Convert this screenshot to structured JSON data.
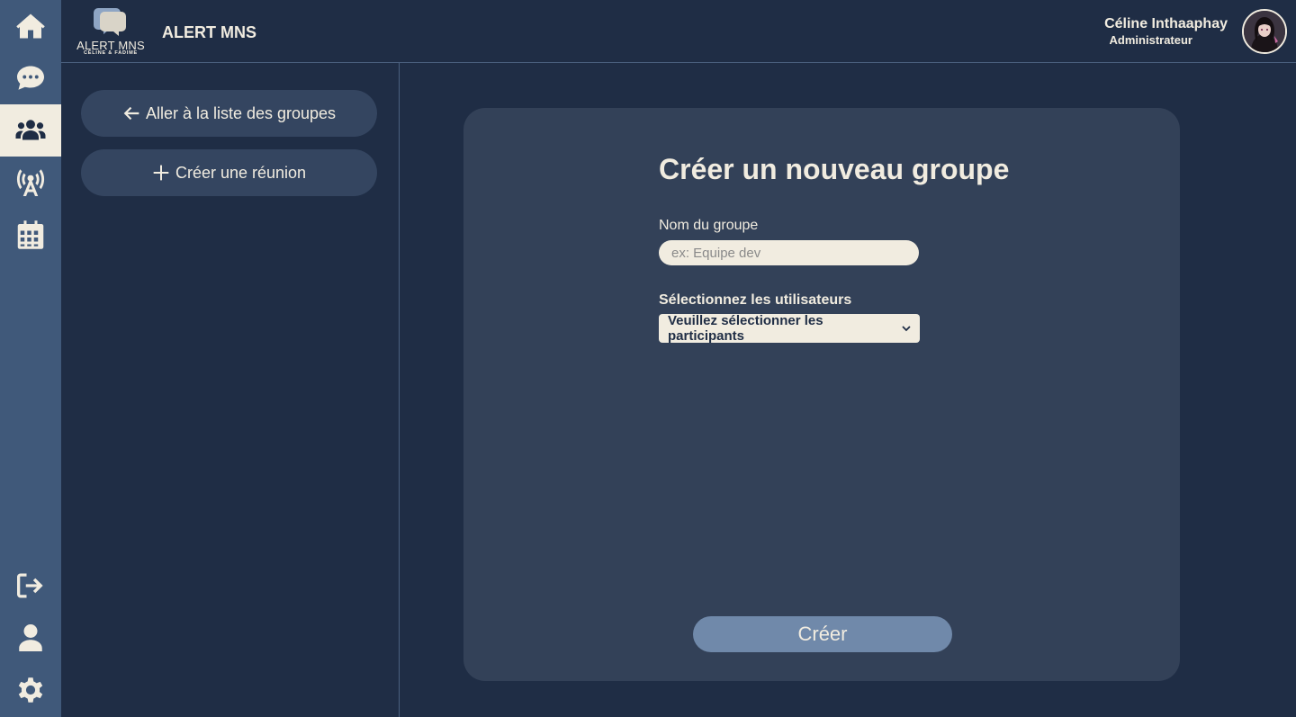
{
  "rail": {
    "items": [
      {
        "icon": "home-icon"
      },
      {
        "icon": "chat-icon"
      },
      {
        "icon": "users-icon",
        "active": true
      },
      {
        "icon": "broadcast-icon"
      },
      {
        "icon": "calendar-icon"
      },
      {
        "icon": "logout-icon"
      },
      {
        "icon": "user-icon"
      },
      {
        "icon": "gear-icon"
      }
    ]
  },
  "header": {
    "logo_text": "ALERT MNS",
    "logo_sub": "CÉLINE & FADIME",
    "app_title": "ALERT MNS",
    "user_name": "Céline Inthaaphay",
    "user_role": "Administrateur"
  },
  "side": {
    "back_label": "Aller à la liste des groupes",
    "meeting_label": "Créer une réunion"
  },
  "form": {
    "title": "Créer un nouveau groupe",
    "name_label": "Nom du groupe",
    "name_placeholder": "ex: Equipe dev",
    "name_value": "",
    "users_label": "Sélectionnez les utilisateurs",
    "users_selected": "Veuillez sélectionner les participants",
    "submit_label": "Créer"
  },
  "colors": {
    "background": "#1f2d45",
    "rail": "#40597a",
    "card": "#334158",
    "cream": "#f1ece0",
    "button": "#7089aa"
  }
}
